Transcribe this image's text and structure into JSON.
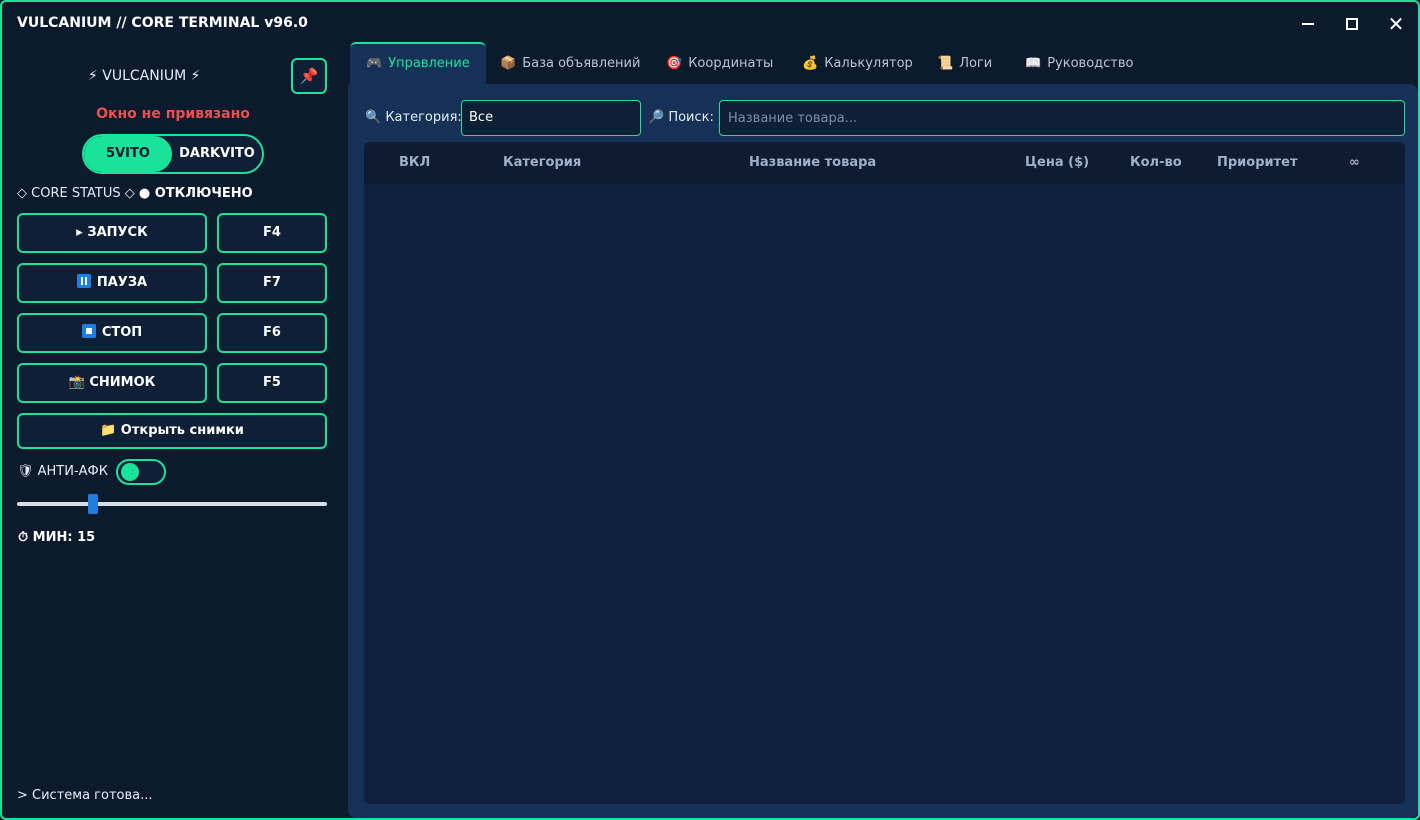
{
  "window": {
    "title": "VULCANIUM // CORE TERMINAL v96.0",
    "close_glyph": "✕"
  },
  "sidebar": {
    "brand": "⚡ VULCANIUM ⚡",
    "pin_icon": "📌",
    "bind_status": "Окно не привязано",
    "platform_switch": {
      "options": [
        "5VITO",
        "DARKVITO"
      ],
      "selected": "5VITO"
    },
    "core_status": {
      "label": "◇ CORE STATUS ◇",
      "state": "● ОТКЛЮЧЕНО"
    },
    "buttons": {
      "start": {
        "label": "▸ ЗАПУСК",
        "hotkey": "F4"
      },
      "pause": {
        "label": "ПАУЗА",
        "hotkey": "F7"
      },
      "stop": {
        "label": "СТОП",
        "hotkey": "F6"
      },
      "snapshot": {
        "label": "📸 СНИМОК",
        "hotkey": "F5"
      },
      "open_snapshots": "📁 Открыть снимки"
    },
    "anti_afk": {
      "label": "🛡 АНТИ-АФК",
      "enabled": true
    },
    "interval_minutes": 15,
    "min_label": "⏱ МИН: 15",
    "console_line": "> Система готова..."
  },
  "tabs": [
    {
      "icon": "🎮",
      "label": "Управление",
      "active": true
    },
    {
      "icon": "📦",
      "label": "База объявлений",
      "active": false
    },
    {
      "icon": "🎯",
      "label": "Координаты",
      "active": false
    },
    {
      "icon": "💰",
      "label": "Калькулятор",
      "active": false
    },
    {
      "icon": "📜",
      "label": "Логи",
      "active": false
    },
    {
      "icon": "📖",
      "label": "Руководство",
      "active": false
    }
  ],
  "filters": {
    "category_label": "Категория:",
    "category_icon": "🔍",
    "category_value": "Все",
    "search_label": "Поиск:",
    "search_icon": "🔎",
    "search_placeholder": "Название товара...",
    "search_value": ""
  },
  "table": {
    "columns": [
      "ВКЛ",
      "Категория",
      "Название товара",
      "Цена ($)",
      "Кол-во",
      "Приоритет",
      "∞"
    ],
    "rows": []
  },
  "colors": {
    "accent": "#19e39a",
    "background": "#0c1a2e",
    "panel": "#163157",
    "error": "#ef4f4f",
    "button_blue": "#1f7fe0"
  }
}
